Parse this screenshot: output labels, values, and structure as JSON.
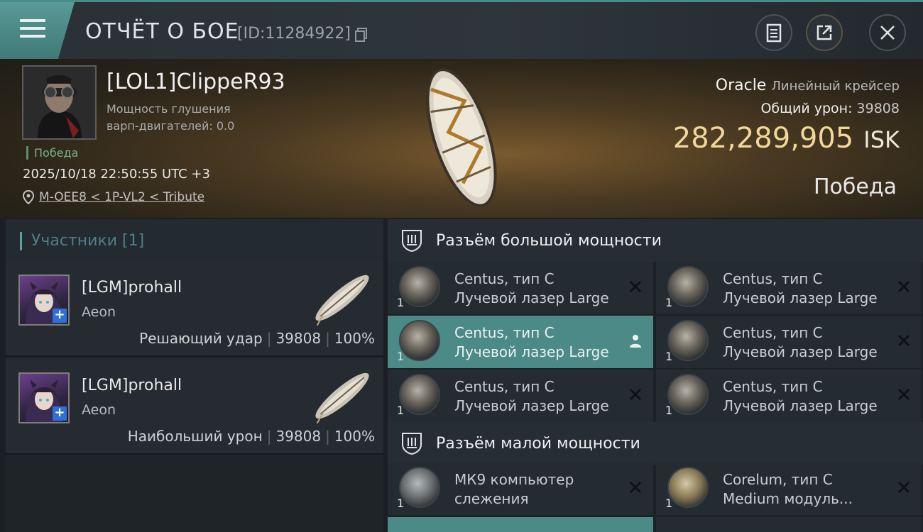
{
  "header": {
    "title": "ОТЧЁТ О БОЕ",
    "battle_id": "[ID:11284922]",
    "icons": [
      "menu-icon",
      "copy-icon",
      "clipboard-icon",
      "share-icon",
      "close-icon"
    ]
  },
  "victim": {
    "name": "[LOL1]ClippeR93",
    "warp_line1": "Мощность глушения",
    "warp_line2": "варп-двигателей: 0.0",
    "status": "Победа",
    "datetime": "2025/10/18 22:50:55 UTC +3",
    "location": "M-OEE8 < 1P-VL2 < Tribute",
    "ship": "Oracle",
    "ship_class": "Линейный крейсер",
    "total_damage_label": "Общий урон:",
    "total_damage": "39808",
    "isk_value": "282,289,905",
    "isk_unit": "ISK",
    "result": "Победа"
  },
  "participants": {
    "title": "Участники [1]",
    "cards": [
      {
        "name": "[LGM]prohall",
        "ship": "Aeon",
        "role": "Решающий удар",
        "damage": "39808",
        "percent": "100%"
      },
      {
        "name": "[LGM]prohall",
        "ship": "Aeon",
        "role": "Наибольший урон",
        "damage": "39808",
        "percent": "100%"
      }
    ]
  },
  "fitting": {
    "high_title": "Разъём большой мощности",
    "high_slots": [
      {
        "l1": "Centus, тип C",
        "l2": "Лучевой лазер Large",
        "qty": "1",
        "active": false
      },
      {
        "l1": "Centus, тип C",
        "l2": "Лучевой лазер Large",
        "qty": "1",
        "active": false
      },
      {
        "l1": "Centus, тип C",
        "l2": "Лучевой лазер Large",
        "qty": "1",
        "active": true
      },
      {
        "l1": "Centus, тип C",
        "l2": "Лучевой лазер Large",
        "qty": "1",
        "active": false
      },
      {
        "l1": "Centus, тип C",
        "l2": "Лучевой лазер Large",
        "qty": "1",
        "active": false
      },
      {
        "l1": "Centus, тип C",
        "l2": "Лучевой лазер Large",
        "qty": "1",
        "active": false
      }
    ],
    "low_title": "Разъём малой мощности",
    "low_slots": [
      {
        "l1": "МК9 компьютер",
        "l2": "слежения",
        "qty": "1"
      },
      {
        "l1": "Corelum, тип C",
        "l2": "Medium модуль...",
        "qty": "1"
      }
    ]
  },
  "colors": {
    "accent": "#4b8a87",
    "isk": "#f0d79a",
    "victory": "#7bb08c"
  }
}
